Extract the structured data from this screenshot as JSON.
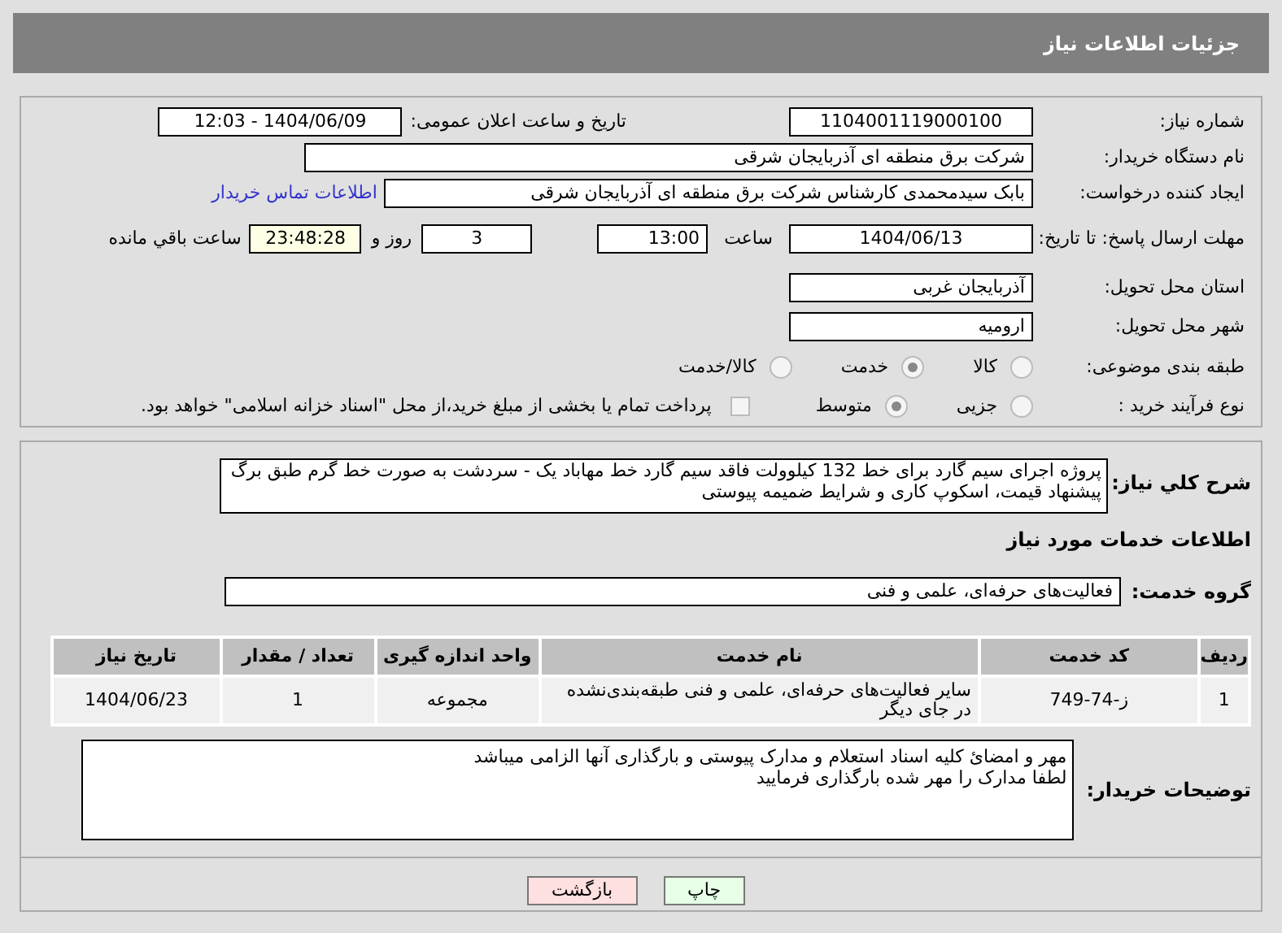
{
  "header": {
    "title": "جزئیات اطلاعات نیاز"
  },
  "need_number": {
    "label": "شماره نیاز:",
    "value": "1104001119000100"
  },
  "announce_datetime": {
    "label": "تاریخ و ساعت اعلان عمومی:",
    "value": "1404/06/09 - 12:03"
  },
  "buyer_org": {
    "label": "نام دستگاه خریدار:",
    "value": "شرکت برق منطقه ای آذربایجان شرقی"
  },
  "requester": {
    "label": "ایجاد کننده درخواست:",
    "value": "بابک سیدمحمدی کارشناس شرکت برق منطقه ای آذربایجان شرقی",
    "link": "اطلاعات تماس خریدار"
  },
  "deadline": {
    "label": "مهلت ارسال پاسخ: تا تاریخ:",
    "date": "1404/06/13",
    "time_label": "ساعت",
    "time": "13:00",
    "days": "3",
    "days_label": "روز و",
    "remaining": "23:48:28",
    "remaining_label": "ساعت باقي مانده"
  },
  "province": {
    "label": "استان محل تحویل:",
    "value": "آذربایجان غربی"
  },
  "city": {
    "label": "شهر محل تحویل:",
    "value": "ارومیه"
  },
  "category": {
    "label": "طبقه بندی موضوعی:",
    "options": [
      {
        "label": "کالا",
        "selected": false
      },
      {
        "label": "خدمت",
        "selected": true
      },
      {
        "label": "کالا/خدمت",
        "selected": false
      }
    ]
  },
  "purchase_type": {
    "label": "نوع فرآیند خرید :",
    "options": [
      {
        "label": "جزیی",
        "selected": false
      },
      {
        "label": "متوسط",
        "selected": true
      }
    ],
    "payment_note": {
      "checked": false,
      "text": "پرداخت تمام یا بخشی از مبلغ خرید،از محل \"اسناد خزانه اسلامی\" خواهد بود."
    }
  },
  "description": {
    "label": "شرح کلي نياز:",
    "value": "پروژه اجرای سیم گارد برای خط 132 کیلوولت فاقد سیم گارد خط مهاباد یک - سردشت به صورت خط گرم طبق برگ پیشنهاد قیمت، اسکوپ کاری و شرایط ضمیمه پیوستی"
  },
  "services_title": "اطلاعات خدمات مورد نیاز",
  "service_group": {
    "label": "گروه خدمت:",
    "value": "فعالیت‌های حرفه‌ای، علمی و فنی"
  },
  "table": {
    "columns": [
      "ردیف",
      "کد خدمت",
      "نام خدمت",
      "واحد اندازه گیری",
      "تعداد / مقدار",
      "تاریخ نیاز"
    ],
    "rows": [
      [
        "1",
        "ز-74-749",
        "سایر فعالیت‌های حرفه‌ای، علمی و فنی طبقه‌بندی‌نشده در جای دیگر",
        "مجموعه",
        "1",
        "1404/06/23"
      ]
    ]
  },
  "buyer_notes": {
    "label": "توضیحات خریدار:",
    "lines": [
      "مهر و امضائ کلیه اسناد استعلام و مدارک پیوستی و بارگذاری آنها الزامی میباشد",
      "لطفا مدارک را مهر شده بارگذاری فرمایید"
    ]
  },
  "buttons": [
    {
      "label": "چاپ",
      "kind": "print"
    },
    {
      "label": "بازگشت",
      "kind": "back"
    }
  ]
}
